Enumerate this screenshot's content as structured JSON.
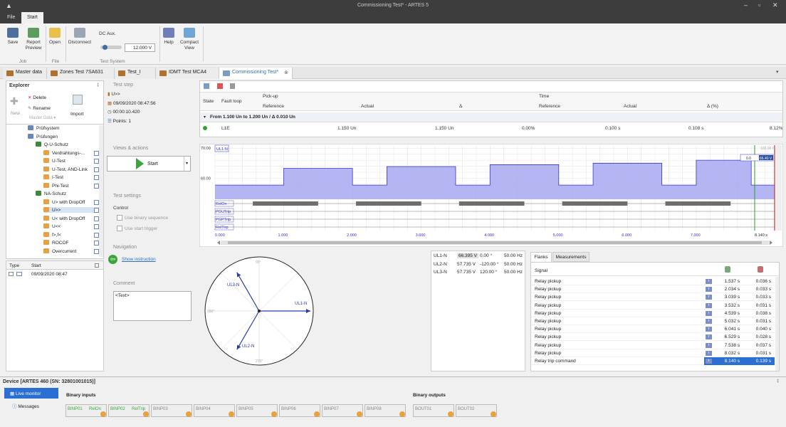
{
  "app": {
    "title": "Commissioning Test* - ARTES 5"
  },
  "menu": {
    "file": "File",
    "start": "Start"
  },
  "ribbon": {
    "save": "Save",
    "report_preview": "Report Preview",
    "open": "Open",
    "disconnect": "Disconnect",
    "dc_aux": "DC Aux.",
    "dc_value": "12.000 V",
    "help": "Help",
    "compact_view": "Compact View",
    "group_job": "Job",
    "group_file": "File",
    "group_test_system": "Test System"
  },
  "tabs": [
    {
      "label": "Master data"
    },
    {
      "label": "Zones Test 7SA631"
    },
    {
      "label": "Test_I"
    },
    {
      "label": "IDMT Test MCA4"
    },
    {
      "label": "Commissioning Test*"
    }
  ],
  "explorer": {
    "title": "Explorer",
    "pin": "‡",
    "delete": "Delete",
    "rename": "Rename",
    "new": "New",
    "master_data": "Master Data ▾",
    "import": "Import",
    "tree": [
      {
        "label": "Prüfsystem",
        "level": 2
      },
      {
        "label": "Prüfungen",
        "level": 2
      },
      {
        "label": "Q-U-Schutz",
        "level": 3
      },
      {
        "label": "Verdrahtungs-...",
        "level": 4
      },
      {
        "label": "U-Test",
        "level": 4
      },
      {
        "label": "U-Test, AND-Link",
        "level": 4
      },
      {
        "label": "I-Test",
        "level": 4
      },
      {
        "label": "Phi-Test",
        "level": 4
      },
      {
        "label": "NA-Schutz",
        "level": 3
      },
      {
        "label": "U> with DropOff",
        "level": 4
      },
      {
        "label": "U>>",
        "level": 4
      },
      {
        "label": "U< with DropOff",
        "level": 4
      },
      {
        "label": "U<<",
        "level": 4
      },
      {
        "label": "f>,f<",
        "level": 4
      },
      {
        "label": "ROCOF",
        "level": 4
      },
      {
        "label": "Overcurrent",
        "level": 4
      }
    ],
    "runs_header": {
      "type": "Type",
      "start": "Start"
    },
    "runs": [
      {
        "start": "09/09/2020 08:47"
      }
    ]
  },
  "teststep": {
    "title": "Test step",
    "name": "U>>",
    "datetime": "09/09/2020 08:47:56",
    "duration": "00:00:10.420",
    "points": "Points: 1",
    "views_actions": "Views & actions",
    "start_btn": "Start",
    "test_settings": "Test settings",
    "control": "Control",
    "use_binary_sequence": "Use binary sequence",
    "use_start_trigger": "Use start trigger",
    "navigation": "Navigation",
    "show_instruction": "Show instruction",
    "comment": "Comment",
    "comment_text": "<Text>"
  },
  "results": {
    "h_state": "State",
    "h_fault_loop": "Fault loop",
    "h_pickup": "Pick-up",
    "h_time": "Time",
    "h_reference": "Reference",
    "h_actual": "Actual",
    "h_delta": "Δ",
    "h_reference2": "Reference",
    "h_actual2": "Actual",
    "h_delta_pct": "Δ (%)",
    "group_row": "From 1.100 Un to 1.200 Un / Δ 0.010 Un",
    "row": {
      "fault_loop": "L1E",
      "ref": "1.150 Un",
      "actual": "1.150 Un",
      "delta": "0.00%",
      "t_ref": "0.100 s",
      "t_actual": "0.108 s",
      "t_delta": "8.12%"
    }
  },
  "chart_data": {
    "type": "line",
    "title": "",
    "series": [
      {
        "name": "UL1-N",
        "x": [
          0,
          0.5,
          0.5,
          1.0,
          1.0,
          2.0,
          2.0,
          2.5,
          2.5,
          3.5,
          3.5,
          4.0,
          4.0,
          5.0,
          5.0,
          5.5,
          5.5,
          6.5,
          6.5,
          7.0,
          7.0,
          7.8,
          7.8,
          8.14
        ],
        "values": [
          57.7,
          57.7,
          57.7,
          57.7,
          63.3,
          63.3,
          57.7,
          57.7,
          63.9,
          63.9,
          57.7,
          57.7,
          64.5,
          64.5,
          57.7,
          57.7,
          65.0,
          65.0,
          57.7,
          57.7,
          66.0,
          66.0,
          57.7,
          57.7
        ]
      }
    ],
    "digital_channels": [
      "RelOn",
      "PGUTrip",
      "PGPTrip",
      "RelTrip"
    ],
    "x_ticks": [
      "0.000",
      "1.000",
      "2.000",
      "3.000",
      "4.000",
      "5.000",
      "6.000",
      "7.000",
      "8.140 s"
    ],
    "y_ticks": [
      "70.00",
      "60.00"
    ],
    "ylim": [
      53,
      71
    ],
    "xlim": [
      0,
      8.14
    ],
    "ruler": "100.00 %",
    "cursor_readout": [
      "0.0",
      "66.40 V"
    ]
  },
  "phasors": {
    "channels": [
      {
        "name": "UL1-N",
        "mag": "66.395 V",
        "angle": "0.00 °",
        "freq": "50.00 Hz"
      },
      {
        "name": "UL2-N",
        "mag": "57.735 V",
        "angle": "-120.00 °",
        "freq": "50.00 Hz"
      },
      {
        "name": "UL3-N",
        "mag": "57.735 V",
        "angle": "120.00 °",
        "freq": "50.00 Hz"
      }
    ],
    "labels": {
      "deg90": "90°",
      "deg180": "180°",
      "deg270": "270°"
    }
  },
  "flanks": {
    "tab_flanks": "Flanks",
    "tab_measurements": "Measurements",
    "h_signal": "Signal",
    "rows": [
      {
        "signal": "Relay pickup",
        "t": "1.537 s",
        "d": "0.036 s"
      },
      {
        "signal": "Relay pickup",
        "t": "2.034 s",
        "d": "0.033 s"
      },
      {
        "signal": "Relay pickup",
        "t": "3.039 s",
        "d": "0.033 s"
      },
      {
        "signal": "Relay pickup",
        "t": "3.532 s",
        "d": "0.031 s"
      },
      {
        "signal": "Relay pickup",
        "t": "4.539 s",
        "d": "0.038 s"
      },
      {
        "signal": "Relay pickup",
        "t": "5.032 s",
        "d": "0.031 s"
      },
      {
        "signal": "Relay pickup",
        "t": "6.041 s",
        "d": "0.040 s"
      },
      {
        "signal": "Relay pickup",
        "t": "6.529 s",
        "d": "0.028 s"
      },
      {
        "signal": "Relay pickup",
        "t": "7.538 s",
        "d": "0.037 s"
      },
      {
        "signal": "Relay pickup",
        "t": "8.032 s",
        "d": "0.031 s"
      },
      {
        "signal": "Relay trip command",
        "t": "8.140 s",
        "d": "0.139 s"
      }
    ]
  },
  "device": {
    "title": "Device [ARTES 460 (SN: 32801001015)]",
    "live_monitor": "Live monitor",
    "messages": "Messages",
    "binary_inputs": "Binary inputs",
    "binary_outputs": "Binary outputs",
    "binps": [
      {
        "label": "BINP01",
        "sub": "RelOn"
      },
      {
        "label": "BINP02",
        "sub": "RelTrip"
      },
      {
        "label": "BINP03",
        "sub": ""
      },
      {
        "label": "BINP04",
        "sub": ""
      },
      {
        "label": "BINP05",
        "sub": ""
      },
      {
        "label": "BINP06",
        "sub": ""
      },
      {
        "label": "BINP07",
        "sub": ""
      },
      {
        "label": "BINP08",
        "sub": ""
      }
    ],
    "bouts": [
      {
        "label": "BOUT01"
      },
      {
        "label": "BOUT02"
      }
    ]
  },
  "colors": {
    "accent": "#2a6fd1",
    "signal_fill": "#a7a8f0",
    "signal_line": "#3535c8",
    "relon_bar": "#6e6e6e"
  }
}
